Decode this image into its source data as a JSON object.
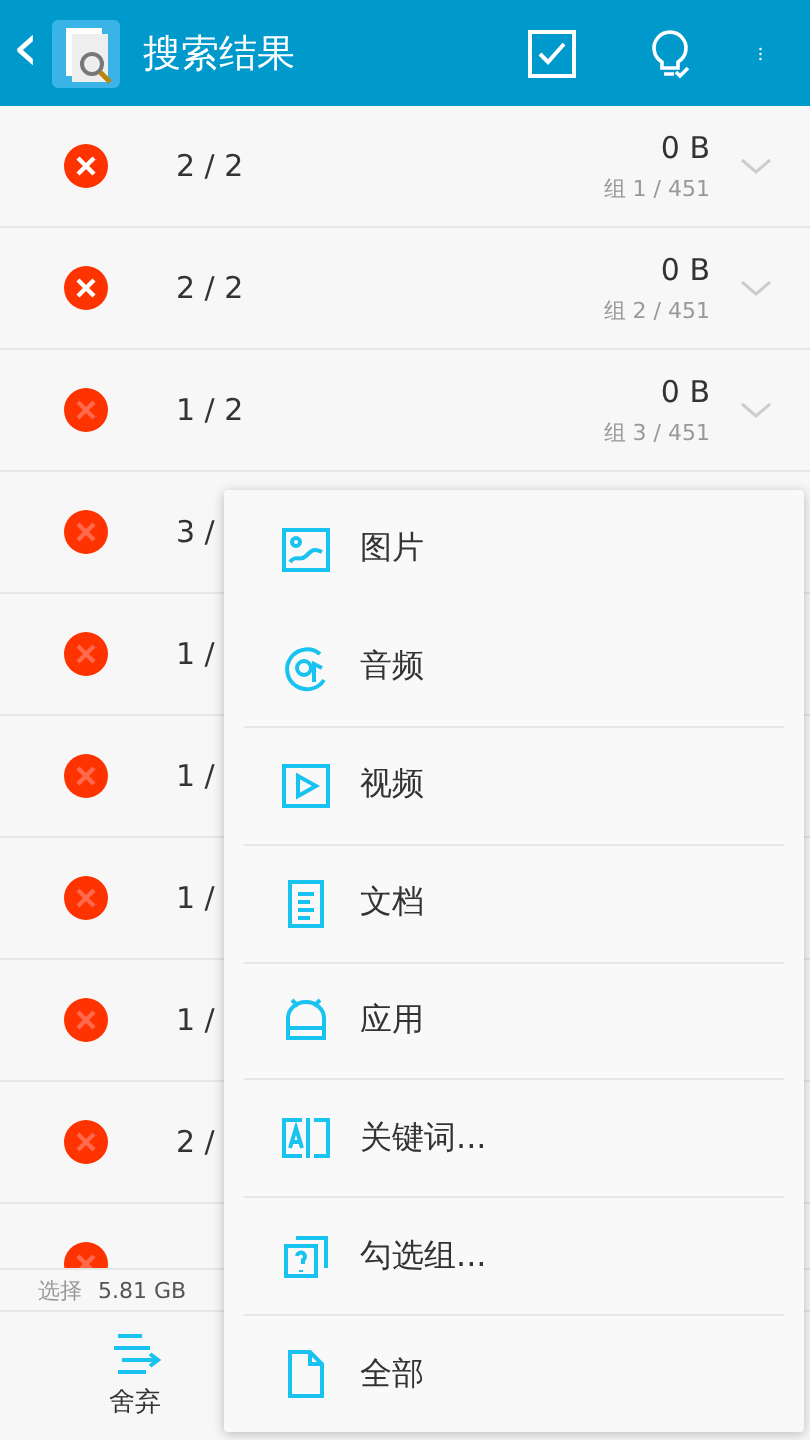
{
  "header": {
    "back": "‹",
    "title": "搜索结果"
  },
  "rows": [
    {
      "count": "2 / 2",
      "size": "0 B",
      "group": "组 1 / 451",
      "active": true
    },
    {
      "count": "2 / 2",
      "size": "0 B",
      "group": "组 2 / 451",
      "active": true
    },
    {
      "count": "1 / 2",
      "size": "0 B",
      "group": "组 3 / 451",
      "active": false
    },
    {
      "count": "3 /",
      "active": false
    },
    {
      "count": "1 /",
      "active": false
    },
    {
      "count": "1 /",
      "active": false
    },
    {
      "count": "1 /",
      "active": false
    },
    {
      "count": "1 /",
      "active": false
    },
    {
      "count": "2 /",
      "active": false
    },
    {
      "active": false
    }
  ],
  "selection": {
    "label": "选择",
    "size": "5.81 GB"
  },
  "bottom_bar": {
    "button": "舍弃"
  },
  "menu": [
    {
      "kind": "image",
      "label": "图片"
    },
    {
      "kind": "audio",
      "label": "音频"
    },
    {
      "kind": "video",
      "label": "视频"
    },
    {
      "kind": "document",
      "label": "文档"
    },
    {
      "kind": "app",
      "label": "应用"
    },
    {
      "kind": "keyword",
      "label": "关键词..."
    },
    {
      "kind": "group",
      "label": "勾选组..."
    },
    {
      "kind": "all",
      "label": "全部"
    }
  ]
}
